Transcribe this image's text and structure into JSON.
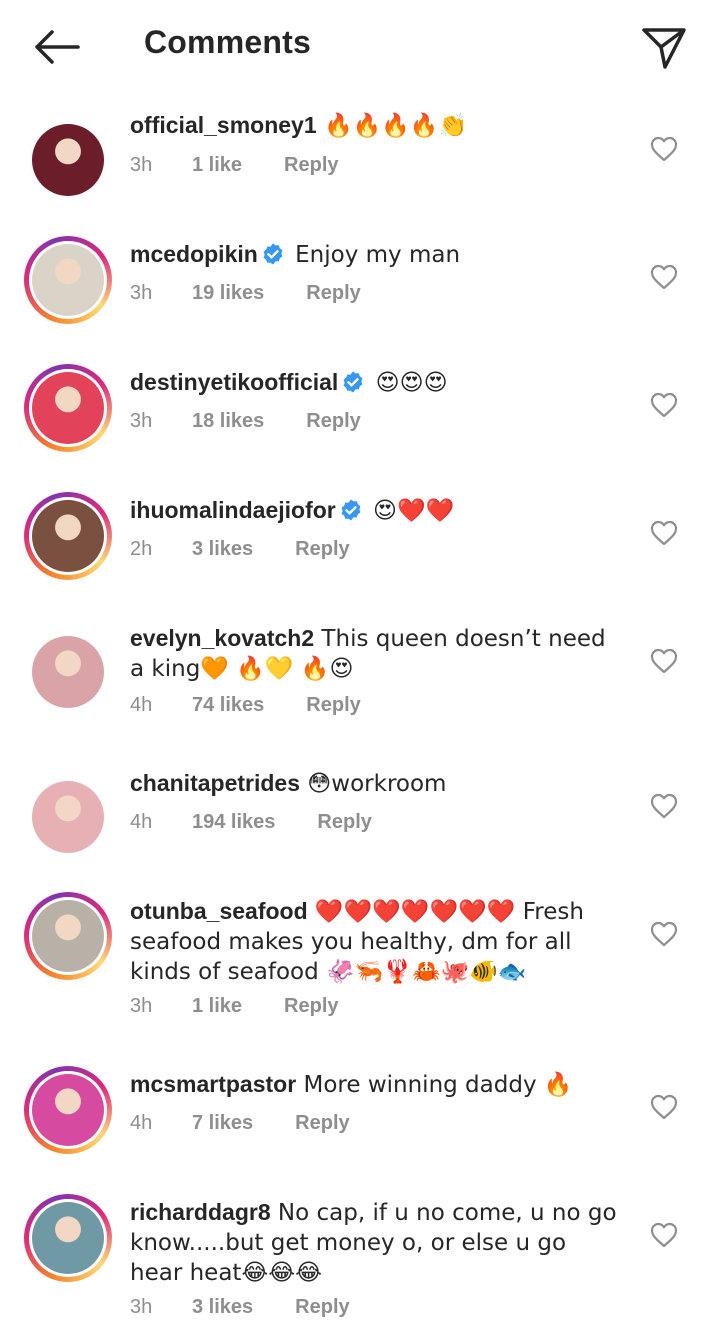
{
  "header": {
    "title": "Comments"
  },
  "comments": [
    {
      "username": "official_smoney1",
      "verified": false,
      "ring": false,
      "text": " 🔥🔥🔥🔥👏",
      "time": "3h",
      "likes": "1 like",
      "reply": "Reply",
      "avatar_color": "#6b1d2a"
    },
    {
      "username": "mcedopikin",
      "verified": true,
      "ring": true,
      "text": " Enjoy my man",
      "time": "3h",
      "likes": "19 likes",
      "reply": "Reply",
      "avatar_color": "#d9d3c8"
    },
    {
      "username": "destinyetikoofficial",
      "verified": true,
      "ring": true,
      "text": "  😍😍😍",
      "time": "3h",
      "likes": "18 likes",
      "reply": "Reply",
      "avatar_color": "#e2435a"
    },
    {
      "username": "ihuomalindaejiofor",
      "verified": true,
      "ring": true,
      "text": " 😍❤️❤️",
      "time": "2h",
      "likes": "3 likes",
      "reply": "Reply",
      "avatar_color": "#7a5040"
    },
    {
      "username": "evelyn_kovatch2",
      "verified": false,
      "ring": false,
      "text": " This queen doesn’t need a king🧡 🔥💛 🔥😍",
      "time": "4h",
      "likes": "74 likes",
      "reply": "Reply",
      "avatar_color": "#d9a3a8"
    },
    {
      "username": "chanitapetrides",
      "verified": false,
      "ring": false,
      "text": " 😳workroom",
      "time": "4h",
      "likes": "194 likes",
      "reply": "Reply",
      "avatar_color": "#e6b0b4"
    },
    {
      "username": "otunba_seafood",
      "verified": false,
      "ring": true,
      "text": " ❤️❤️❤️❤️❤️❤️❤️ Fresh seafood makes you healthy, dm for all kinds of seafood 🦑🦐🦞🦀🐙🐠🐟",
      "time": "3h",
      "likes": "1 like",
      "reply": "Reply",
      "avatar_color": "#b8b1a7"
    },
    {
      "username": "mcsmartpastor",
      "verified": false,
      "ring": true,
      "text": " More winning daddy 🔥",
      "time": "4h",
      "likes": "7 likes",
      "reply": "Reply",
      "avatar_color": "#d64aa0"
    },
    {
      "username": "richarddagr8",
      "verified": false,
      "ring": true,
      "text": " No cap, if u no come, u no go know.....but get money o, or else u go hear heat😂😂😂",
      "time": "3h",
      "likes": "3 likes",
      "reply": "Reply",
      "avatar_color": "#6f9aa5"
    }
  ],
  "icons": {
    "back": "arrow-left-icon",
    "send": "send-paper-plane-icon",
    "like": "heart-outline-icon",
    "verified": "verified-badge-icon"
  },
  "colors": {
    "text": "#262626",
    "muted": "#8e8e8e",
    "verified": "#3897f0"
  }
}
